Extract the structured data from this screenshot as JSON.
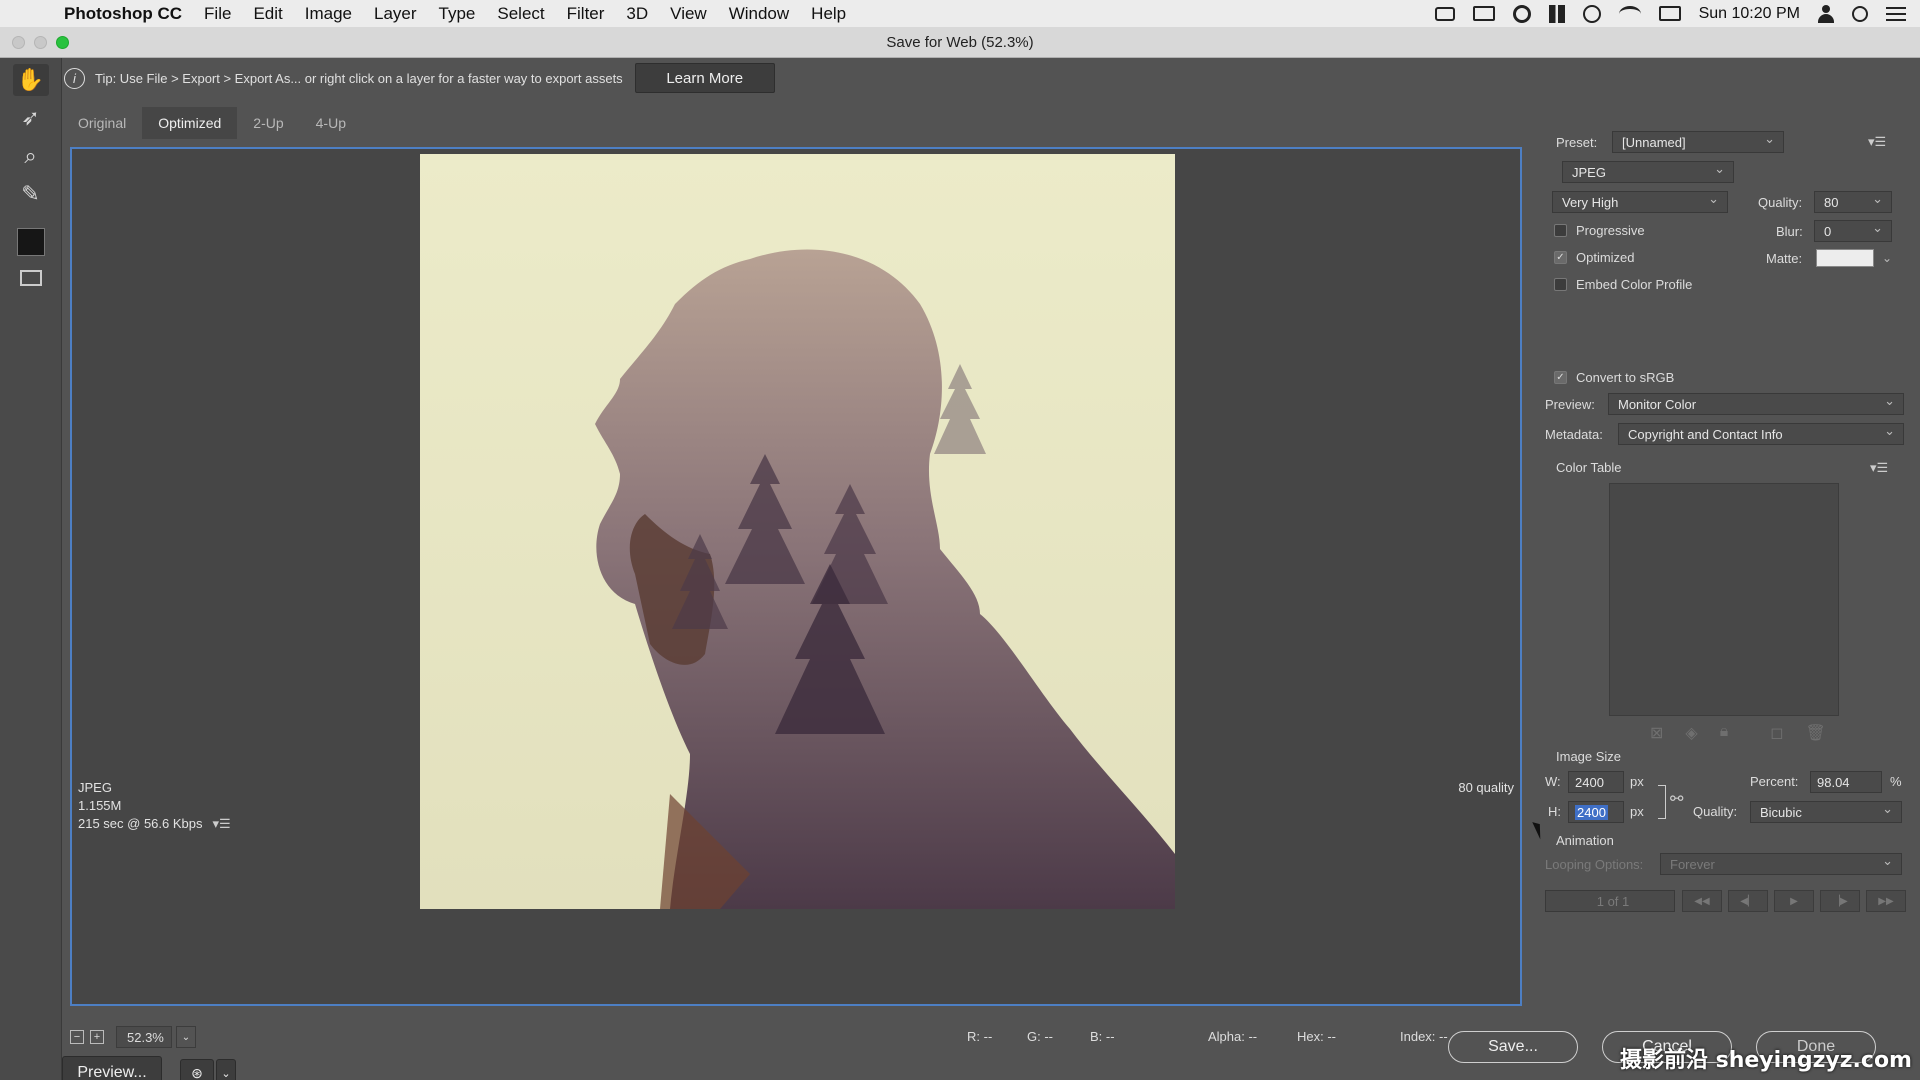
{
  "menubar": {
    "app": "Photoshop CC",
    "items": [
      "File",
      "Edit",
      "Image",
      "Layer",
      "Type",
      "Select",
      "Filter",
      "3D",
      "View",
      "Window",
      "Help"
    ],
    "clock": "Sun 10:20 PM"
  },
  "window": {
    "title": "Save for Web (52.3%)"
  },
  "tip": {
    "text": "Tip: Use File > Export > Export As...  or right click on a layer for a faster way to export assets",
    "button": "Learn More"
  },
  "tabs": [
    "Original",
    "Optimized",
    "2-Up",
    "4-Up"
  ],
  "canvas_info": {
    "format": "JPEG",
    "size": "1.155M",
    "time": "215 sec @ 56.6 Kbps",
    "quality": "80 quality"
  },
  "status": {
    "zoom": "52.3%",
    "r": "R: --",
    "g": "G: --",
    "b": "B: --",
    "alpha": "Alpha: --",
    "hex": "Hex: --",
    "index": "Index: --"
  },
  "bottom": {
    "preview": "Preview...",
    "save": "Save...",
    "cancel": "Cancel",
    "done": "Done"
  },
  "panel": {
    "preset_label": "Preset:",
    "preset": "[Unnamed]",
    "format": "JPEG",
    "compression": "Very High",
    "quality_label": "Quality:",
    "quality": "80",
    "progressive": "Progressive",
    "blur_label": "Blur:",
    "blur": "0",
    "optimized": "Optimized",
    "matte_label": "Matte:",
    "embed": "Embed Color Profile",
    "convert": "Convert to sRGB",
    "preview_label": "Preview:",
    "preview": "Monitor Color",
    "metadata_label": "Metadata:",
    "metadata": "Copyright and Contact Info",
    "color_table": "Color Table",
    "image_size": "Image Size",
    "w_label": "W:",
    "w": "2400",
    "h_label": "H:",
    "h": "2400",
    "px": "px",
    "percent_label": "Percent:",
    "percent": "98.04",
    "percent_unit": "%",
    "resample_label": "Quality:",
    "resample": "Bicubic",
    "animation": "Animation",
    "looping_label": "Looping Options:",
    "looping": "Forever",
    "frame": "1 of 1"
  },
  "watermark": "摄影前沿 sheyingzyz.com"
}
